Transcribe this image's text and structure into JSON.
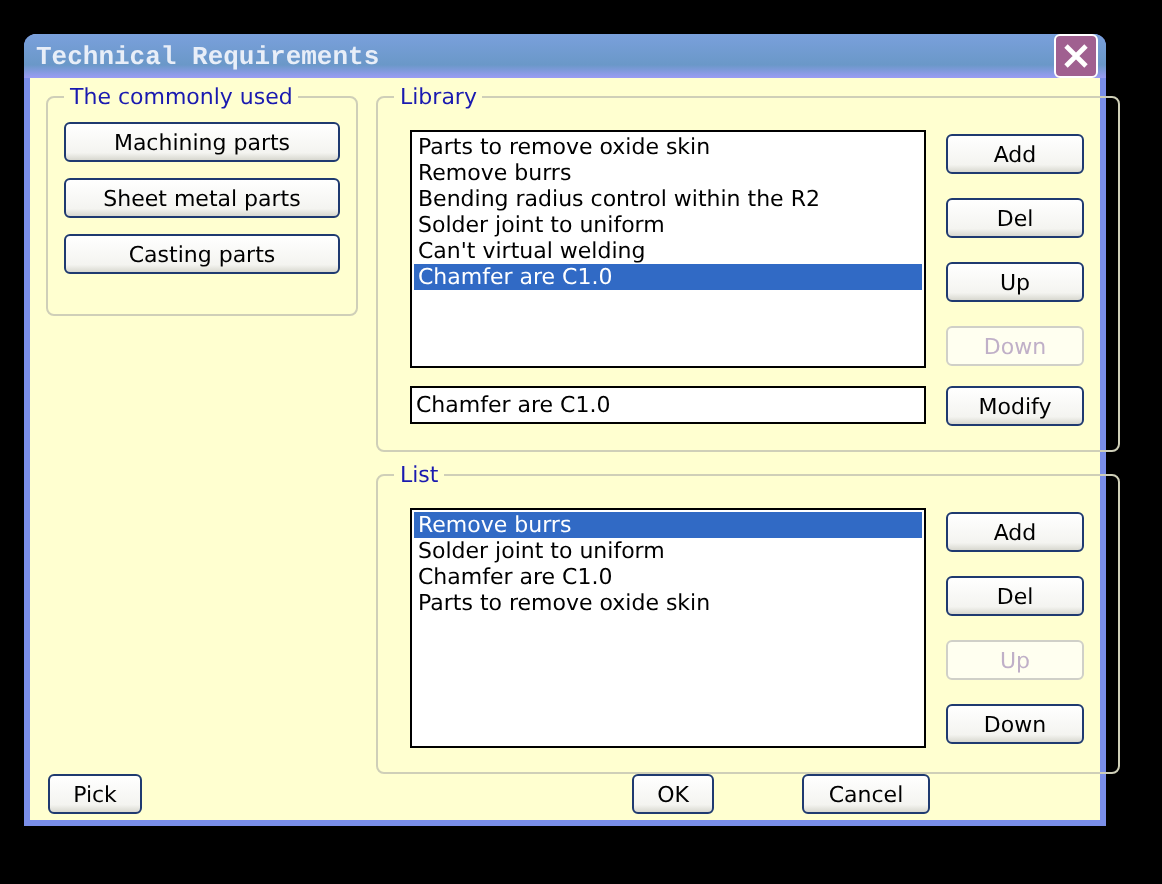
{
  "window": {
    "title": "Technical Requirements"
  },
  "common": {
    "title": "The commonly used",
    "buttons": [
      {
        "label": "Machining parts"
      },
      {
        "label": "Sheet metal parts"
      },
      {
        "label": "Casting parts"
      }
    ]
  },
  "library": {
    "title": "Library",
    "items": [
      {
        "label": "Parts to remove oxide skin",
        "selected": false
      },
      {
        "label": "Remove burrs",
        "selected": false
      },
      {
        "label": "Bending radius control within the R2",
        "selected": false
      },
      {
        "label": "Solder joint to uniform",
        "selected": false
      },
      {
        "label": "Can't virtual welding",
        "selected": false
      },
      {
        "label": "Chamfer are C1.0",
        "selected": true
      }
    ],
    "buttons": [
      {
        "label": "Add",
        "disabled": false
      },
      {
        "label": "Del",
        "disabled": false
      },
      {
        "label": "Up",
        "disabled": false
      },
      {
        "label": "Down",
        "disabled": true
      }
    ],
    "input": {
      "value": "Chamfer are C1.0"
    },
    "modify_button": {
      "label": "Modify",
      "disabled": false
    }
  },
  "list": {
    "title": "List",
    "items": [
      {
        "label": "Remove burrs",
        "selected": true
      },
      {
        "label": "Solder joint to uniform",
        "selected": false
      },
      {
        "label": "Chamfer are C1.0",
        "selected": false
      },
      {
        "label": "Parts to remove oxide skin",
        "selected": false
      }
    ],
    "buttons": [
      {
        "label": "Add",
        "disabled": false
      },
      {
        "label": "Del",
        "disabled": false
      },
      {
        "label": "Up",
        "disabled": true
      },
      {
        "label": "Down",
        "disabled": false
      }
    ]
  },
  "footer": {
    "pick": {
      "label": "Pick"
    },
    "ok": {
      "label": "OK"
    },
    "cancel": {
      "label": "Cancel"
    }
  }
}
